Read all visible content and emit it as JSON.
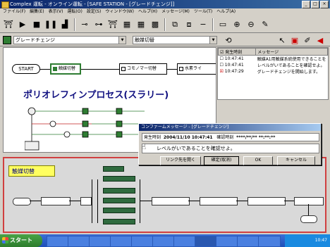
{
  "window": {
    "title": "Complex 運転 - オンライン運転 - [SAFE STATION - [グレードチェンジ]]"
  },
  "menu": [
    "ファイル(F)",
    "編集(E)",
    "表示(V)",
    "運転(O)",
    "設定(S)",
    "ウィンドウ(W)",
    "ヘルプ(H)",
    "メッセージ(M)",
    "ツール(T)",
    "ヘルプ(A)"
  ],
  "toolbar2": {
    "left_select": "グレードチェンジ",
    "right_select": "触媒切替"
  },
  "diagram": {
    "start_label": "START",
    "step1": "触媒切替",
    "step2": "コモノマー切替",
    "step3": "水素ライ",
    "title": "ポリオレフィンプロセス(スラリー)"
  },
  "alarm": {
    "col_time": "発生時刻",
    "col_message": "メッセージ",
    "rows": [
      {
        "time": "10:47:41",
        "message": "触媒A1用触媒系統使用できることを"
      },
      {
        "time": "10:47:41",
        "message": "レベルがいであることを確認せよ。"
      },
      {
        "time": "10:47:29",
        "message": "グレードチェンジを開始します。"
      }
    ]
  },
  "dialog": {
    "title": "コンファームメッセージ - [グレードチェンジ]",
    "time_label": "発生時刻",
    "time_value": "2004/11/10 10:47:41",
    "confirm_label": "確認時刻",
    "confirm_value": "****/**/** **:**:**",
    "message": "レベルがいであることを確認せよ。",
    "btn_link": "リンク先を開く",
    "btn_confirm": "確定(取消)",
    "btn_ok": "OK",
    "btn_cancel": "キャンセル"
  },
  "bottom": {
    "title": "触媒切替"
  },
  "taskbar": {
    "start": "スタート",
    "clock": "10:47"
  }
}
